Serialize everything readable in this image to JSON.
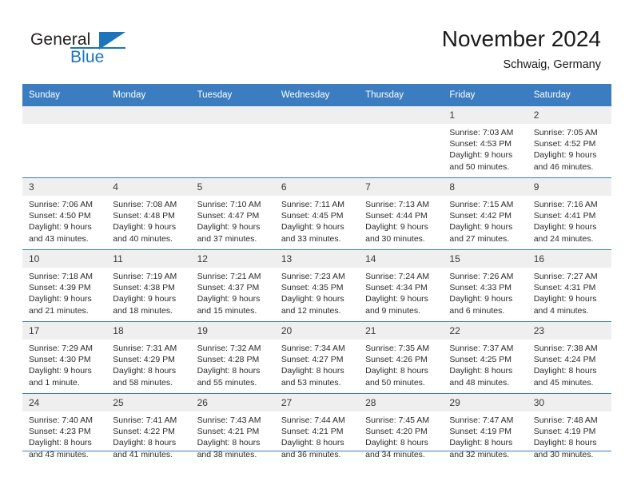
{
  "brand": {
    "word_general": "General",
    "word_blue": "Blue",
    "logo_icon": "general-blue-triangle-logo"
  },
  "header": {
    "title": "November 2024",
    "subtitle": "Schwaig, Germany"
  },
  "colors": {
    "header_blue": "#3b7dc0",
    "daynum_band": "#efefef",
    "brand_blue": "#1b75bb",
    "text": "#2b2b2b"
  },
  "weekday_headers": [
    "Sunday",
    "Monday",
    "Tuesday",
    "Wednesday",
    "Thursday",
    "Friday",
    "Saturday"
  ],
  "labels": {
    "sunrise_prefix": "Sunrise:",
    "sunset_prefix": "Sunset:",
    "daylight_prefix": "Daylight:"
  },
  "weeks": [
    [
      {
        "day": "",
        "sunrise": "",
        "sunset": "",
        "daylight_line1": "",
        "daylight_line2": ""
      },
      {
        "day": "",
        "sunrise": "",
        "sunset": "",
        "daylight_line1": "",
        "daylight_line2": ""
      },
      {
        "day": "",
        "sunrise": "",
        "sunset": "",
        "daylight_line1": "",
        "daylight_line2": ""
      },
      {
        "day": "",
        "sunrise": "",
        "sunset": "",
        "daylight_line1": "",
        "daylight_line2": ""
      },
      {
        "day": "",
        "sunrise": "",
        "sunset": "",
        "daylight_line1": "",
        "daylight_line2": ""
      },
      {
        "day": "1",
        "sunrise": "Sunrise: 7:03 AM",
        "sunset": "Sunset: 4:53 PM",
        "daylight_line1": "Daylight: 9 hours",
        "daylight_line2": "and 50 minutes."
      },
      {
        "day": "2",
        "sunrise": "Sunrise: 7:05 AM",
        "sunset": "Sunset: 4:52 PM",
        "daylight_line1": "Daylight: 9 hours",
        "daylight_line2": "and 46 minutes."
      }
    ],
    [
      {
        "day": "3",
        "sunrise": "Sunrise: 7:06 AM",
        "sunset": "Sunset: 4:50 PM",
        "daylight_line1": "Daylight: 9 hours",
        "daylight_line2": "and 43 minutes."
      },
      {
        "day": "4",
        "sunrise": "Sunrise: 7:08 AM",
        "sunset": "Sunset: 4:48 PM",
        "daylight_line1": "Daylight: 9 hours",
        "daylight_line2": "and 40 minutes."
      },
      {
        "day": "5",
        "sunrise": "Sunrise: 7:10 AM",
        "sunset": "Sunset: 4:47 PM",
        "daylight_line1": "Daylight: 9 hours",
        "daylight_line2": "and 37 minutes."
      },
      {
        "day": "6",
        "sunrise": "Sunrise: 7:11 AM",
        "sunset": "Sunset: 4:45 PM",
        "daylight_line1": "Daylight: 9 hours",
        "daylight_line2": "and 33 minutes."
      },
      {
        "day": "7",
        "sunrise": "Sunrise: 7:13 AM",
        "sunset": "Sunset: 4:44 PM",
        "daylight_line1": "Daylight: 9 hours",
        "daylight_line2": "and 30 minutes."
      },
      {
        "day": "8",
        "sunrise": "Sunrise: 7:15 AM",
        "sunset": "Sunset: 4:42 PM",
        "daylight_line1": "Daylight: 9 hours",
        "daylight_line2": "and 27 minutes."
      },
      {
        "day": "9",
        "sunrise": "Sunrise: 7:16 AM",
        "sunset": "Sunset: 4:41 PM",
        "daylight_line1": "Daylight: 9 hours",
        "daylight_line2": "and 24 minutes."
      }
    ],
    [
      {
        "day": "10",
        "sunrise": "Sunrise: 7:18 AM",
        "sunset": "Sunset: 4:39 PM",
        "daylight_line1": "Daylight: 9 hours",
        "daylight_line2": "and 21 minutes."
      },
      {
        "day": "11",
        "sunrise": "Sunrise: 7:19 AM",
        "sunset": "Sunset: 4:38 PM",
        "daylight_line1": "Daylight: 9 hours",
        "daylight_line2": "and 18 minutes."
      },
      {
        "day": "12",
        "sunrise": "Sunrise: 7:21 AM",
        "sunset": "Sunset: 4:37 PM",
        "daylight_line1": "Daylight: 9 hours",
        "daylight_line2": "and 15 minutes."
      },
      {
        "day": "13",
        "sunrise": "Sunrise: 7:23 AM",
        "sunset": "Sunset: 4:35 PM",
        "daylight_line1": "Daylight: 9 hours",
        "daylight_line2": "and 12 minutes."
      },
      {
        "day": "14",
        "sunrise": "Sunrise: 7:24 AM",
        "sunset": "Sunset: 4:34 PM",
        "daylight_line1": "Daylight: 9 hours",
        "daylight_line2": "and 9 minutes."
      },
      {
        "day": "15",
        "sunrise": "Sunrise: 7:26 AM",
        "sunset": "Sunset: 4:33 PM",
        "daylight_line1": "Daylight: 9 hours",
        "daylight_line2": "and 6 minutes."
      },
      {
        "day": "16",
        "sunrise": "Sunrise: 7:27 AM",
        "sunset": "Sunset: 4:31 PM",
        "daylight_line1": "Daylight: 9 hours",
        "daylight_line2": "and 4 minutes."
      }
    ],
    [
      {
        "day": "17",
        "sunrise": "Sunrise: 7:29 AM",
        "sunset": "Sunset: 4:30 PM",
        "daylight_line1": "Daylight: 9 hours",
        "daylight_line2": "and 1 minute."
      },
      {
        "day": "18",
        "sunrise": "Sunrise: 7:31 AM",
        "sunset": "Sunset: 4:29 PM",
        "daylight_line1": "Daylight: 8 hours",
        "daylight_line2": "and 58 minutes."
      },
      {
        "day": "19",
        "sunrise": "Sunrise: 7:32 AM",
        "sunset": "Sunset: 4:28 PM",
        "daylight_line1": "Daylight: 8 hours",
        "daylight_line2": "and 55 minutes."
      },
      {
        "day": "20",
        "sunrise": "Sunrise: 7:34 AM",
        "sunset": "Sunset: 4:27 PM",
        "daylight_line1": "Daylight: 8 hours",
        "daylight_line2": "and 53 minutes."
      },
      {
        "day": "21",
        "sunrise": "Sunrise: 7:35 AM",
        "sunset": "Sunset: 4:26 PM",
        "daylight_line1": "Daylight: 8 hours",
        "daylight_line2": "and 50 minutes."
      },
      {
        "day": "22",
        "sunrise": "Sunrise: 7:37 AM",
        "sunset": "Sunset: 4:25 PM",
        "daylight_line1": "Daylight: 8 hours",
        "daylight_line2": "and 48 minutes."
      },
      {
        "day": "23",
        "sunrise": "Sunrise: 7:38 AM",
        "sunset": "Sunset: 4:24 PM",
        "daylight_line1": "Daylight: 8 hours",
        "daylight_line2": "and 45 minutes."
      }
    ],
    [
      {
        "day": "24",
        "sunrise": "Sunrise: 7:40 AM",
        "sunset": "Sunset: 4:23 PM",
        "daylight_line1": "Daylight: 8 hours",
        "daylight_line2": "and 43 minutes."
      },
      {
        "day": "25",
        "sunrise": "Sunrise: 7:41 AM",
        "sunset": "Sunset: 4:22 PM",
        "daylight_line1": "Daylight: 8 hours",
        "daylight_line2": "and 41 minutes."
      },
      {
        "day": "26",
        "sunrise": "Sunrise: 7:43 AM",
        "sunset": "Sunset: 4:21 PM",
        "daylight_line1": "Daylight: 8 hours",
        "daylight_line2": "and 38 minutes."
      },
      {
        "day": "27",
        "sunrise": "Sunrise: 7:44 AM",
        "sunset": "Sunset: 4:21 PM",
        "daylight_line1": "Daylight: 8 hours",
        "daylight_line2": "and 36 minutes."
      },
      {
        "day": "28",
        "sunrise": "Sunrise: 7:45 AM",
        "sunset": "Sunset: 4:20 PM",
        "daylight_line1": "Daylight: 8 hours",
        "daylight_line2": "and 34 minutes."
      },
      {
        "day": "29",
        "sunrise": "Sunrise: 7:47 AM",
        "sunset": "Sunset: 4:19 PM",
        "daylight_line1": "Daylight: 8 hours",
        "daylight_line2": "and 32 minutes."
      },
      {
        "day": "30",
        "sunrise": "Sunrise: 7:48 AM",
        "sunset": "Sunset: 4:19 PM",
        "daylight_line1": "Daylight: 8 hours",
        "daylight_line2": "and 30 minutes."
      }
    ]
  ]
}
